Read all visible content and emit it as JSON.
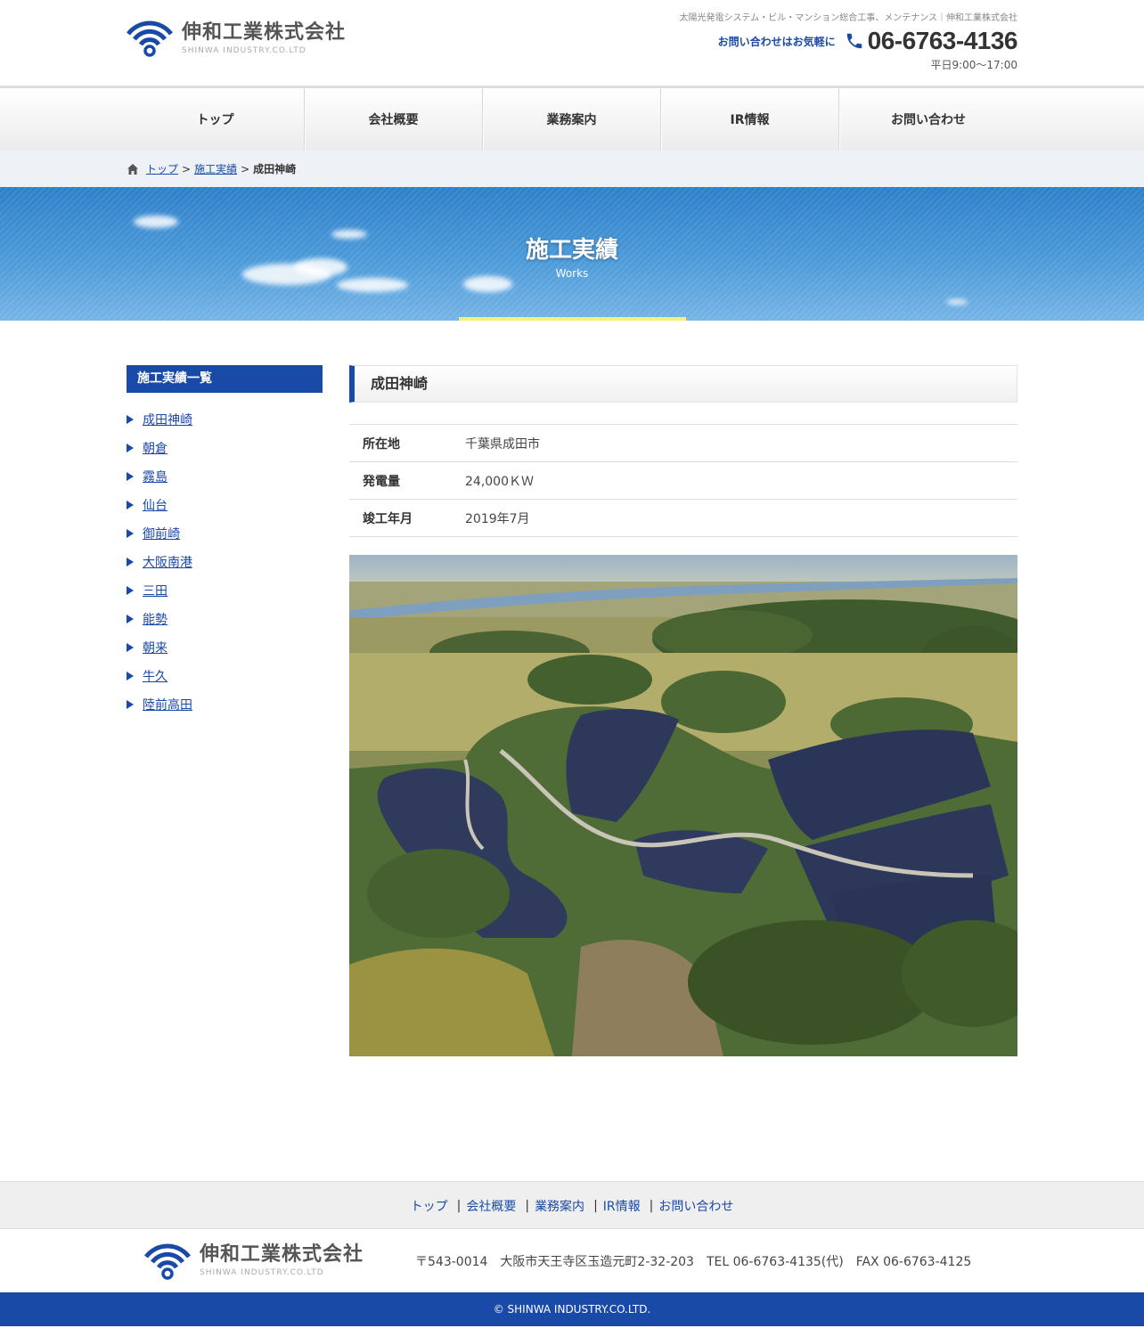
{
  "header": {
    "logo_jp": "伸和工業株式会社",
    "logo_en": "SHINWA INDUSTRY.CO.LTD",
    "tagline": "太陽光発電システム・ビル・マンション総合工事、メンテナンス｜伸和工業株式会社",
    "contact_lead": "お問い合わせはお気軽に",
    "phone": "06-6763-4136",
    "hours": "平日9:00～17:00"
  },
  "nav": [
    "トップ",
    "会社概要",
    "業務案内",
    "IR情報",
    "お問い合わせ"
  ],
  "breadcrumb": {
    "home": "トップ",
    "section": "施工実績",
    "current": "成田神崎",
    "sep": ">"
  },
  "hero": {
    "title": "施工実績",
    "subtitle": "Works"
  },
  "sidebar": {
    "heading": "施工実績一覧",
    "items": [
      "成田神崎",
      "朝倉",
      "霧島",
      "仙台",
      "御前崎",
      "大阪南港",
      "三田",
      "能勢",
      "朝来",
      "牛久",
      "陸前高田"
    ]
  },
  "work": {
    "title": "成田神崎",
    "rows": [
      {
        "label": "所在地",
        "value": "千葉県成田市"
      },
      {
        "label": "発電量",
        "value": "24,000ＫＷ"
      },
      {
        "label": "竣工年月",
        "value": "2019年7月"
      }
    ]
  },
  "footer": {
    "links": [
      "トップ",
      "会社概要",
      "業務案内",
      "IR情報",
      "お問い合わせ"
    ],
    "separator": "|",
    "logo_jp": "伸和工業株式会社",
    "logo_en": "SHINWA INDUSTRY.CO.LTD",
    "address": "〒543-0014　大阪市天王寺区玉造元町2-32-203　TEL 06-6763-4135(代)　FAX 06-6763-4125",
    "copyright": "© SHINWA INDUSTRY.CO.LTD."
  },
  "colors": {
    "brand": "#1a4aa8",
    "accent": "#f5f07a"
  },
  "icons": {
    "phone": "phone-icon",
    "home": "home-icon",
    "logo": "wifi-logo-icon"
  }
}
